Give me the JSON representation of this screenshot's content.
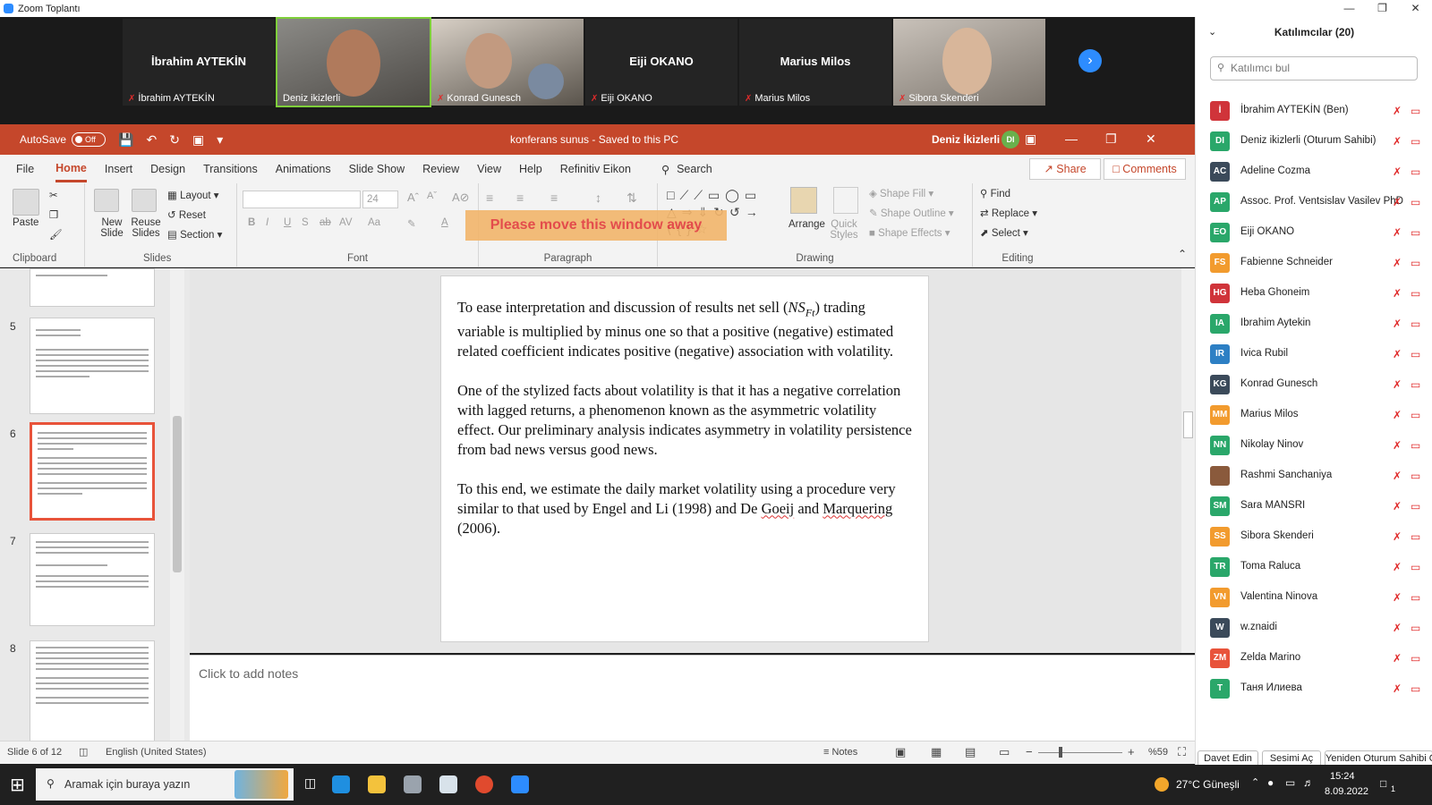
{
  "zoom": {
    "window_title": "Zoom Toplantı",
    "tiles": [
      {
        "big": "İbrahim AYTEKİN",
        "label": "İbrahim AYTEKİN"
      },
      {
        "big": "",
        "label": "Deniz ikizlerli"
      },
      {
        "big": "",
        "label": "Konrad Gunesch"
      },
      {
        "big": "Eiji OKANO",
        "label": "Eiji OKANO"
      },
      {
        "big": "Marius Milos",
        "label": "Marius Milos"
      },
      {
        "big": "",
        "label": "Sibora Skenderi"
      }
    ],
    "next_icon": "chevron-right-icon"
  },
  "ppt": {
    "autosave_label": "AutoSave",
    "autosave_state": "Off",
    "doc_title": "konferans sunus  -  Saved to this PC",
    "user_name": "Deniz İkizlerli",
    "user_initials": "DI",
    "tabs": [
      "File",
      "Home",
      "Insert",
      "Design",
      "Transitions",
      "Animations",
      "Slide Show",
      "Review",
      "View",
      "Help",
      "Refinitiv Eikon"
    ],
    "active_tab": "Home",
    "search_label": "Search",
    "share_label": "Share",
    "comments_label": "Comments",
    "ribbon": {
      "clipboard": {
        "paste": "Paste",
        "group": "Clipboard"
      },
      "slides": {
        "new_slide": "New Slide",
        "reuse_slides": "Reuse Slides",
        "layout": "Layout",
        "reset": "Reset",
        "section": "Section",
        "group": "Slides"
      },
      "font": {
        "size": "24",
        "group": "Font"
      },
      "paragraph": {
        "group": "Paragraph"
      },
      "drawing": {
        "arrange": "Arrange",
        "quick_styles": "Quick Styles",
        "shape_fill": "Shape Fill",
        "shape_outline": "Shape Outline",
        "shape_effects": "Shape Effects",
        "group": "Drawing"
      },
      "editing": {
        "find": "Find",
        "replace": "Replace",
        "select": "Select",
        "group": "Editing"
      }
    },
    "warning_overlay": "Please move this window away",
    "thumb_numbers": [
      "5",
      "6",
      "7",
      "8"
    ],
    "slide": {
      "p1_pre": "To ease interpretation and discussion of results net sell (",
      "p1_math": "NS",
      "p1_sub": "Ft",
      "p1_post": ")  trading variable is multiplied by minus one so that a positive (negative) estimated related coefficient indicates positive (negative) association with volatility.",
      "p2": "One of the stylized facts about volatility is that it has a negative correlation with lagged returns, a phenomenon known as the asymmetric volatility effect. Our preliminary analysis indicates asymmetry in volatility persistence from bad news versus good news.",
      "p3_pre": "To this end, we estimate the daily market volatility using a procedure very similar to that used by Engel and Li (1998) and De ",
      "p3_goeij": "Goeij",
      "p3_and": " and ",
      "p3_marq": "Marquering",
      "p3_post": " (2006)."
    },
    "notes_placeholder": "Click to add notes",
    "status": {
      "slide_pos": "Slide 6 of 12",
      "language": "English (United States)",
      "notes": "Notes",
      "zoom": "%59"
    }
  },
  "participants": {
    "title": "Katılımcılar (20)",
    "search_placeholder": "Katılımcı bul",
    "list": [
      {
        "initials": "İ",
        "name": "İbrahim AYTEKİN (Ben)",
        "color": "#d0343a"
      },
      {
        "initials": "DI",
        "name": "Deniz ikizlerli (Oturum Sahibi)",
        "color": "#2aa76a"
      },
      {
        "initials": "AC",
        "name": "Adeline Cozma",
        "color": "#3b4a5a"
      },
      {
        "initials": "AP",
        "name": "Assoc. Prof. Ventsislav Vasilev PhD",
        "color": "#2aa76a"
      },
      {
        "initials": "EO",
        "name": "Eiji OKANO",
        "color": "#2aa76a"
      },
      {
        "initials": "FS",
        "name": "Fabienne Schneider",
        "color": "#f29b2e"
      },
      {
        "initials": "HG",
        "name": "Heba Ghoneim",
        "color": "#d0343a"
      },
      {
        "initials": "IA",
        "name": "Ibrahim Aytekin",
        "color": "#2aa76a"
      },
      {
        "initials": "IR",
        "name": "Ivica Rubil",
        "color": "#2d7fc4"
      },
      {
        "initials": "KG",
        "name": "Konrad Gunesch",
        "color": "#3b4a5a"
      },
      {
        "initials": "MM",
        "name": "Marius Milos",
        "color": "#f29b2e"
      },
      {
        "initials": "NN",
        "name": "Nikolay Ninov",
        "color": "#2aa76a"
      },
      {
        "initials": "",
        "name": "Rashmi Sanchaniya",
        "color": "#8a5a3c"
      },
      {
        "initials": "SM",
        "name": "Sara MANSRI",
        "color": "#2aa76a"
      },
      {
        "initials": "SS",
        "name": "Sibora Skenderi",
        "color": "#f29b2e"
      },
      {
        "initials": "TR",
        "name": "Toma Raluca",
        "color": "#2aa76a"
      },
      {
        "initials": "VN",
        "name": "Valentina Ninova",
        "color": "#f29b2e"
      },
      {
        "initials": "W",
        "name": "w.znaidi",
        "color": "#3b4a5a"
      },
      {
        "initials": "ZM",
        "name": "Zelda Marino",
        "color": "#e8533a"
      },
      {
        "initials": "T",
        "name": "Таня Илиева",
        "color": "#2aa76a"
      }
    ],
    "buttons": [
      "Davet Edin",
      "Sesimi Aç",
      "Yeniden Oturum Sahibi O"
    ]
  },
  "taskbar": {
    "search_placeholder": "Aramak için buraya yazın",
    "weather": "27°C  Güneşli",
    "time": "15:24",
    "date": "8.09.2022",
    "notif_count": "1"
  }
}
